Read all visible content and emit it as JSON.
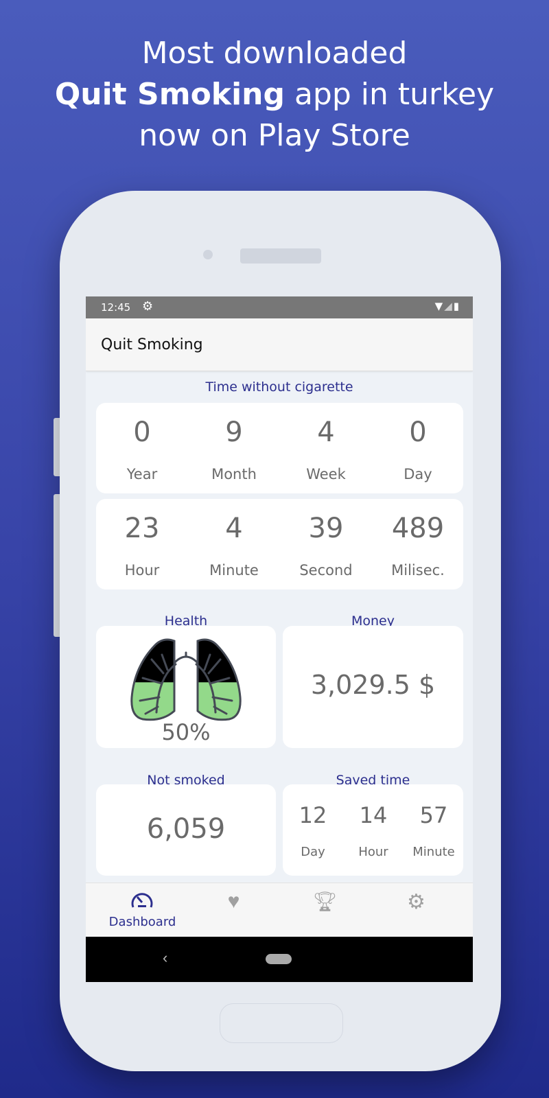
{
  "promo": {
    "line1": "Most downloaded",
    "line2_bold": "Quit Smoking",
    "line2_rest": " app in turkey",
    "line3": "now on Play Store"
  },
  "status_bar": {
    "time": "12:45"
  },
  "app_bar": {
    "title": "Quit Smoking"
  },
  "time_without": {
    "title": "Time without cigarette",
    "row1": [
      {
        "value": "0",
        "unit": "Year"
      },
      {
        "value": "9",
        "unit": "Month"
      },
      {
        "value": "4",
        "unit": "Week"
      },
      {
        "value": "0",
        "unit": "Day"
      }
    ],
    "row2": [
      {
        "value": "23",
        "unit": "Hour"
      },
      {
        "value": "4",
        "unit": "Minute"
      },
      {
        "value": "39",
        "unit": "Second"
      },
      {
        "value": "489",
        "unit": "Milisec."
      }
    ]
  },
  "health": {
    "title": "Health",
    "percent": "50%",
    "fill_fraction": 0.5
  },
  "money": {
    "title": "Money",
    "value": "3,029.5 $"
  },
  "not_smoked": {
    "title": "Not smoked",
    "value": "6,059"
  },
  "saved_time": {
    "title": "Saved time",
    "items": [
      {
        "value": "12",
        "unit": "Day"
      },
      {
        "value": "14",
        "unit": "Hour"
      },
      {
        "value": "57",
        "unit": "Minute"
      }
    ]
  },
  "bottom_nav": {
    "items": [
      {
        "label": "Dashboard",
        "icon": "dashboard-gauge-icon",
        "active": true
      },
      {
        "icon": "heart-pulse-icon"
      },
      {
        "icon": "trophy-icon"
      },
      {
        "icon": "gear-icon"
      }
    ]
  },
  "colors": {
    "accent": "#2c2f8e",
    "lung_fill": "#93d98a",
    "background": "#3844a8"
  }
}
